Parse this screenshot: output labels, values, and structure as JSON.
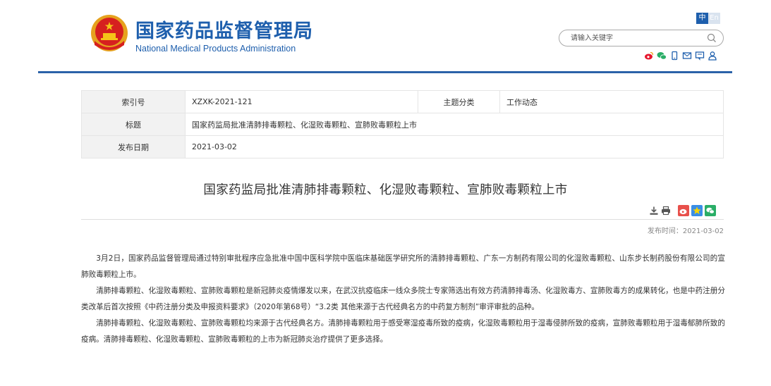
{
  "header": {
    "logo_cn": "国家药品监督管理局",
    "logo_en": "National Medical Products Administration",
    "lang_zh": "中",
    "lang_en": "En",
    "search_placeholder": "请输入关键字",
    "icons": [
      "emblem-icon",
      "weibo-icon",
      "wechat-icon",
      "mobile-icon",
      "mail-icon",
      "message-icon",
      "user-icon"
    ],
    "colors": {
      "brand": "#1e5fad",
      "divider": "#2b62a8"
    }
  },
  "meta": {
    "index_label": "索引号",
    "index_value": "XZXK-2021-121",
    "category_label": "主题分类",
    "category_value": "工作动态",
    "title_label": "标题",
    "title_value": "国家药监局批准清肺排毒颗粒、化湿败毒颗粒、宣肺败毒颗粒上市",
    "date_label": "发布日期",
    "date_value": "2021-03-02"
  },
  "article": {
    "title": "国家药监局批准清肺排毒颗粒、化湿败毒颗粒、宣肺败毒颗粒上市",
    "pubtime": "发布时间：2021-03-02",
    "paragraphs": [
      "3月2日，国家药品监督管理局通过特别审批程序应急批准中国中医科学院中医临床基础医学研究所的清肺排毒颗粒、广东一方制药有限公司的化湿败毒颗粒、山东步长制药股份有限公司的宣肺败毒颗粒上市。",
      "清肺排毒颗粒、化湿败毒颗粒、宣肺败毒颗粒是新冠肺炎疫情爆发以来，在武汉抗疫临床一线众多院士专家筛选出有效方药清肺排毒汤、化湿败毒方、宣肺败毒方的成果转化，也是中药注册分类改革后首次按照《中药注册分类及申报资料要求》（2020年第68号）“3.2类 其他来源于古代经典名方的中药复方制剂”审评审批的品种。",
      "清肺排毒颗粒、化湿败毒颗粒、宣肺败毒颗粒均来源于古代经典名方。清肺排毒颗粒用于感受寒湿疫毒所致的疫病，化湿败毒颗粒用于湿毒侵肺所致的疫病，宣肺败毒颗粒用于湿毒郁肺所致的疫病。清肺排毒颗粒、化湿败毒颗粒、宣肺败毒颗粒的上市为新冠肺炎治疗提供了更多选择。"
    ]
  }
}
